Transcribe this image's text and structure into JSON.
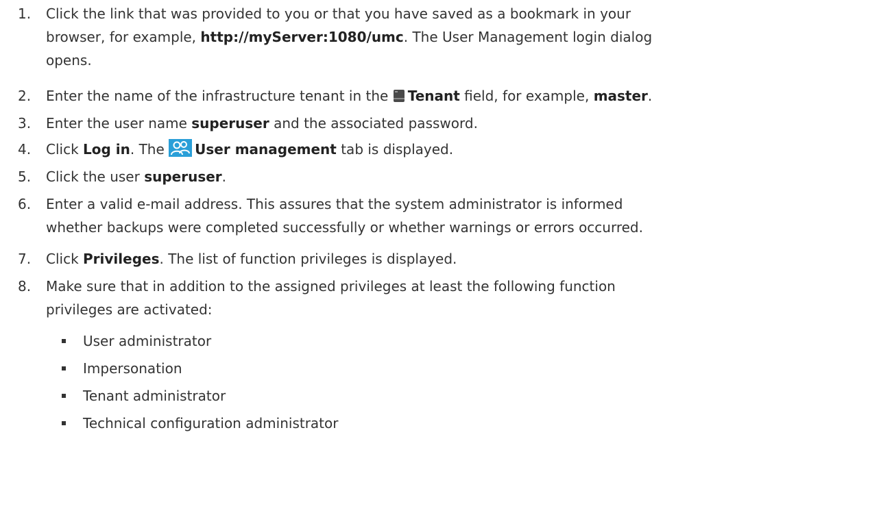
{
  "steps": [
    {
      "num": "1.",
      "line1_a": "Click the link that was provided to you or that you have saved as a bookmark in your",
      "line2_a": "browser, for example, ",
      "line2_b": "http://myServer:1080/umc",
      "line2_c": ". The User Management login dialog",
      "line3": "opens."
    },
    {
      "num": "2.",
      "a": "Enter the name of the infrastructure tenant in the ",
      "icon": "tenant-icon",
      "b": "Tenant",
      "c": " field, for example, ",
      "d": "master",
      "e": "."
    },
    {
      "num": "3.",
      "a": "Enter the user name ",
      "b": "superuser",
      "c": " and the associated password."
    },
    {
      "num": "4.",
      "a": "Click ",
      "b": "Log in",
      "c": ". The ",
      "icon": "user-management-icon",
      "d": "User management",
      "e": " tab is displayed."
    },
    {
      "num": "5.",
      "a": "Click the user ",
      "b": "superuser",
      "c": "."
    },
    {
      "num": "6.",
      "line1": "Enter a valid e-mail address. This assures that the system administrator is informed",
      "line2": "whether backups were completed successfully or whether warnings or errors occurred."
    },
    {
      "num": "7.",
      "a": "Click ",
      "b": "Privileges",
      "c": ". The list of function privileges is displayed."
    },
    {
      "num": "8.",
      "line1": "Make sure that in addition to the assigned privileges at least the following function",
      "line2": "privileges are activated:"
    }
  ],
  "bullets": [
    "User administrator",
    "Impersonation",
    "Tenant administrator",
    "Technical configuration administrator"
  ],
  "colors": {
    "text": "#333333",
    "icon_gray": "#4a4a4a",
    "icon_blue": "#2a9fd8"
  }
}
